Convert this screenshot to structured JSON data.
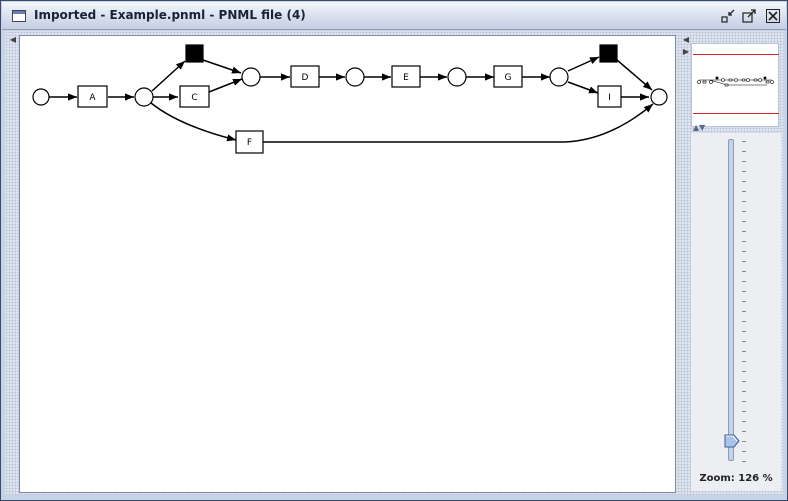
{
  "window": {
    "title": "Imported - Example.pnml - PNML file (4)",
    "buttons": [
      {
        "name": "minimize-button",
        "icon": "minimize-icon"
      },
      {
        "name": "maximize-button",
        "icon": "maximize-icon"
      },
      {
        "name": "close-button",
        "icon": "close-icon"
      }
    ]
  },
  "colors": {
    "titlebar": "#d8e0ee",
    "canvas_background": "#ffffff",
    "overview_frame": "#d42a2a",
    "node_stroke": "#000000",
    "silent_transition": "#000000"
  },
  "petri_net": {
    "places": [
      "p-start",
      "p1",
      "p2",
      "p3",
      "p4",
      "p5",
      "p-end"
    ],
    "transitions": [
      {
        "id": "A",
        "label": "A"
      },
      {
        "id": "tau1",
        "label": "",
        "silent": true
      },
      {
        "id": "C",
        "label": "C"
      },
      {
        "id": "F",
        "label": "F"
      },
      {
        "id": "D",
        "label": "D"
      },
      {
        "id": "E",
        "label": "E"
      },
      {
        "id": "G",
        "label": "G"
      },
      {
        "id": "tau2",
        "label": "",
        "silent": true
      },
      {
        "id": "I",
        "label": "I"
      }
    ]
  },
  "zoom": {
    "label": "Zoom: 126 %",
    "value_percent": 126
  }
}
